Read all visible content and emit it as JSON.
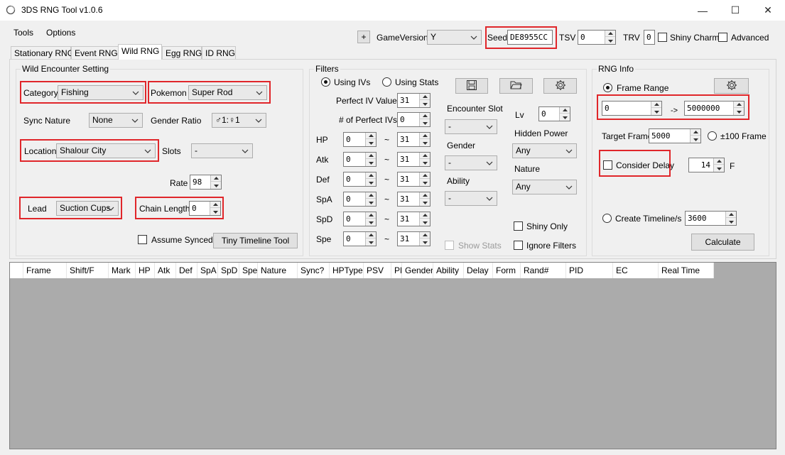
{
  "window": {
    "title": "3DS RNG Tool v1.0.6",
    "minimize": "—",
    "maximize": "☐",
    "close": "✕"
  },
  "menu": [
    "Tools",
    "Options"
  ],
  "top": {
    "plus_label": "+",
    "game_version_label": "GameVersion",
    "game_version_value": "Y",
    "seed_label": "Seed",
    "seed_value": "DE8955CC",
    "tsv_label": "TSV",
    "tsv_value": "0",
    "trv_label": "TRV",
    "trv_value": "0",
    "shiny_charm_label": "Shiny Charm",
    "advanced_label": "Advanced"
  },
  "tabs": [
    "Stationary RNG",
    "Event RNG",
    "Wild RNG",
    "Egg RNG",
    "ID RNG"
  ],
  "wild": {
    "group_title": "Wild Encounter Setting",
    "category_label": "Category",
    "category_value": "Fishing",
    "pokemon_label": "Pokemon",
    "pokemon_value": "Super Rod",
    "sync_nature_label": "Sync Nature",
    "sync_nature_value": "None",
    "gender_ratio_label": "Gender Ratio",
    "gender_ratio_value": "♂1:♀1",
    "location_label": "Location",
    "location_value": "Shalour City",
    "slots_label": "Slots",
    "slots_value": "-",
    "rate_label": "Rate",
    "rate_value": "98",
    "lead_label": "Lead",
    "lead_value": "Suction Cups",
    "chain_length_label": "Chain Length",
    "chain_length_value": "0",
    "assume_synced_label": "Assume Synced",
    "tiny_timeline_label": "Tiny Timeline Tool"
  },
  "filters": {
    "group_title": "Filters",
    "using_ivs_label": "Using IVs",
    "using_stats_label": "Using Stats",
    "perfect_iv_label": "Perfect IV Value",
    "perfect_iv_value": "31",
    "num_perfect_label": "# of Perfect IVs",
    "num_perfect_value": "0",
    "stats": [
      {
        "name": "HP",
        "min": "0",
        "tilde": "~",
        "max": "31"
      },
      {
        "name": "Atk",
        "min": "0",
        "tilde": "~",
        "max": "31"
      },
      {
        "name": "Def",
        "min": "0",
        "tilde": "~",
        "max": "31"
      },
      {
        "name": "SpA",
        "min": "0",
        "tilde": "~",
        "max": "31"
      },
      {
        "name": "SpD",
        "min": "0",
        "tilde": "~",
        "max": "31"
      },
      {
        "name": "Spe",
        "min": "0",
        "tilde": "~",
        "max": "31"
      }
    ],
    "encounter_slot_label": "Encounter Slot",
    "encounter_slot_value": "-",
    "gender_label": "Gender",
    "gender_value": "-",
    "ability_label": "Ability",
    "ability_value": "-",
    "lv_label": "Lv",
    "lv_value": "0",
    "hidden_power_label": "Hidden Power",
    "hidden_power_value": "Any",
    "nature_label": "Nature",
    "nature_value": "Any",
    "shiny_only_label": "Shiny Only",
    "show_stats_label": "Show Stats",
    "ignore_filters_label": "Ignore Filters"
  },
  "rnginfo": {
    "group_title": "RNG Info",
    "frame_range_label": "Frame Range",
    "frame_from": "0",
    "arrow": "->",
    "frame_to": "5000000",
    "target_frame_label": "Target Frame",
    "target_frame_value": "5000",
    "plus100_label": "±100 Frame",
    "consider_delay_label": "Consider Delay",
    "delay_value": "14",
    "f_label": "F",
    "create_timeline_label": "Create Timeline/s",
    "timeline_value": "3600",
    "calculate_label": "Calculate"
  },
  "grid_columns": [
    "Frame",
    "Shift/F",
    "Mark",
    "HP",
    "Atk",
    "Def",
    "SpA",
    "SpD",
    "Spe",
    "Nature",
    "Sync?",
    "HPType",
    "PSV",
    "PP",
    "Gender",
    "Ability",
    "Delay",
    "Form",
    "Rand#",
    "PID",
    "EC",
    "Real Time"
  ],
  "colors": {
    "highlight": "#e0262a",
    "grid_background": "#ababab"
  }
}
